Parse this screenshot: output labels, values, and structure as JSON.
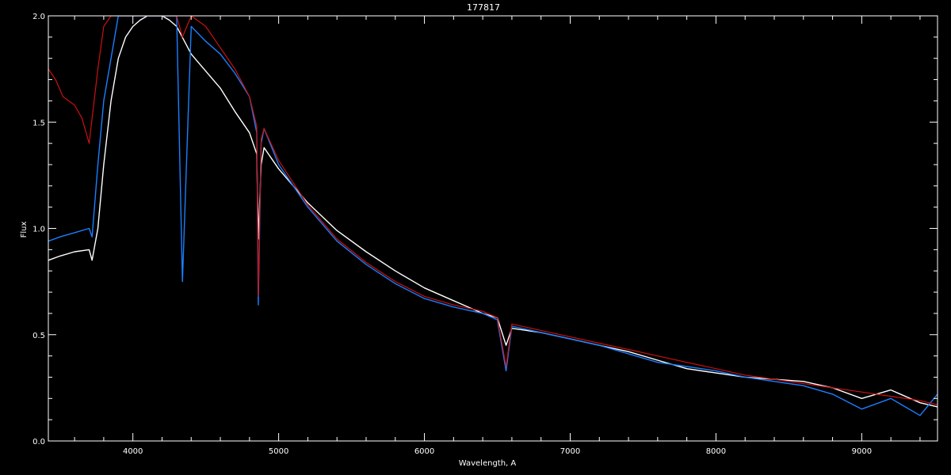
{
  "chart_data": {
    "type": "line",
    "title": "177817",
    "xlabel": "Wavelength, A",
    "ylabel": "Flux",
    "xlim": [
      3420,
      9520
    ],
    "ylim": [
      0.0,
      2.0
    ],
    "xticks": [
      4000,
      5000,
      6000,
      7000,
      8000,
      9000
    ],
    "xtick_labels": [
      "4000",
      "5000",
      "6000",
      "7000",
      "8000",
      "9000"
    ],
    "yticks": [
      0.0,
      0.5,
      1.0,
      1.5,
      2.0
    ],
    "ytick_labels": [
      "0.0",
      "0.5",
      "1.0",
      "1.5",
      "2.0"
    ],
    "grid": false,
    "colors": {
      "background": "#000000",
      "axes": "#ffffff",
      "observed": "#ffffff",
      "corrected": "#1a7fff",
      "model": "#cc1111"
    },
    "series": [
      {
        "key": "observed",
        "color": "#ffffff",
        "x": [
          3420,
          3500,
          3600,
          3700,
          3720,
          3760,
          3800,
          3850,
          3900,
          3950,
          4000,
          4050,
          4100,
          4150,
          4200,
          4250,
          4300,
          4400,
          4500,
          4600,
          4700,
          4800,
          4850,
          4860,
          4880,
          4900,
          5000,
          5200,
          5400,
          5600,
          5800,
          6000,
          6200,
          6400,
          6500,
          6560,
          6600,
          6800,
          7000,
          7200,
          7400,
          7600,
          7800,
          8000,
          8200,
          8400,
          8600,
          8800,
          9000,
          9200,
          9400,
          9520
        ],
        "y": [
          0.85,
          0.87,
          0.89,
          0.9,
          0.85,
          1.0,
          1.3,
          1.6,
          1.8,
          1.9,
          1.95,
          1.98,
          2.0,
          2.0,
          2.0,
          1.98,
          1.95,
          1.82,
          1.74,
          1.66,
          1.55,
          1.45,
          1.35,
          0.95,
          1.3,
          1.38,
          1.28,
          1.12,
          0.99,
          0.89,
          0.8,
          0.72,
          0.66,
          0.6,
          0.58,
          0.45,
          0.53,
          0.51,
          0.48,
          0.45,
          0.42,
          0.38,
          0.34,
          0.32,
          0.3,
          0.29,
          0.28,
          0.25,
          0.2,
          0.24,
          0.18,
          0.16
        ]
      },
      {
        "key": "corrected",
        "color": "#1a7fff",
        "x": [
          3420,
          3500,
          3600,
          3700,
          3720,
          3760,
          3800,
          3850,
          3900,
          3950,
          4000,
          4050,
          4100,
          4150,
          4200,
          4250,
          4300,
          4340,
          4400,
          4500,
          4600,
          4700,
          4800,
          4850,
          4860,
          4880,
          4900,
          5000,
          5200,
          5400,
          5600,
          5800,
          6000,
          6200,
          6400,
          6500,
          6560,
          6600,
          6800,
          7000,
          7200,
          7400,
          7600,
          7800,
          8000,
          8200,
          8400,
          8600,
          8800,
          9000,
          9200,
          9400,
          9520
        ],
        "y": [
          0.94,
          0.96,
          0.98,
          1.0,
          0.96,
          1.3,
          1.6,
          1.8,
          2.0,
          2.0,
          2.0,
          2.0,
          2.0,
          2.0,
          2.0,
          2.0,
          2.0,
          0.75,
          1.95,
          1.88,
          1.82,
          1.73,
          1.62,
          1.45,
          0.64,
          1.4,
          1.47,
          1.3,
          1.1,
          0.94,
          0.83,
          0.74,
          0.67,
          0.63,
          0.6,
          0.57,
          0.33,
          0.54,
          0.51,
          0.48,
          0.45,
          0.41,
          0.37,
          0.35,
          0.33,
          0.3,
          0.28,
          0.26,
          0.22,
          0.15,
          0.2,
          0.12,
          0.22
        ]
      },
      {
        "key": "model",
        "color": "#cc1111",
        "x": [
          3420,
          3470,
          3520,
          3600,
          3650,
          3700,
          3760,
          3800,
          3850,
          3900,
          4000,
          4100,
          4200,
          4300,
          4340,
          4400,
          4500,
          4600,
          4700,
          4800,
          4850,
          4860,
          4880,
          4900,
          5000,
          5200,
          5400,
          5600,
          5800,
          6000,
          6200,
          6400,
          6500,
          6560,
          6600,
          6800,
          7000,
          7200,
          7400,
          7600,
          7800,
          8000,
          8200,
          8400,
          8600,
          8800,
          9000,
          9200,
          9400,
          9520
        ],
        "y": [
          1.75,
          1.7,
          1.62,
          1.58,
          1.52,
          1.4,
          1.75,
          1.95,
          2.0,
          2.0,
          2.0,
          2.0,
          2.0,
          2.0,
          1.9,
          2.0,
          1.95,
          1.85,
          1.75,
          1.62,
          1.48,
          0.68,
          1.42,
          1.47,
          1.32,
          1.11,
          0.95,
          0.84,
          0.75,
          0.68,
          0.64,
          0.61,
          0.58,
          0.35,
          0.55,
          0.52,
          0.49,
          0.46,
          0.43,
          0.4,
          0.37,
          0.34,
          0.31,
          0.29,
          0.27,
          0.25,
          0.23,
          0.21,
          0.19,
          0.17
        ]
      }
    ]
  }
}
